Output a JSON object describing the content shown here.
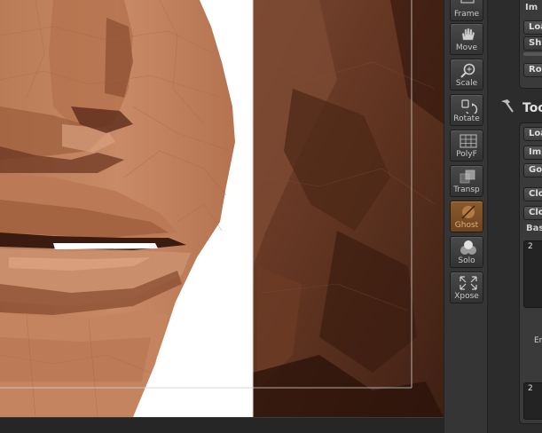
{
  "shelf": {
    "frame_label": "Frame",
    "move_label": "Move",
    "scale_label": "Scale",
    "rotate_label": "Rotate",
    "polyf_label": "PolyF",
    "transp_label": "Transp",
    "ghost_label": "Ghost",
    "solo_label": "Solo",
    "xpose_label": "Xpose"
  },
  "tray": {
    "image_panel": {
      "header": "Im",
      "load_label": "Loa",
      "shift_label": "Shi",
      "r_label": "Ro"
    },
    "tool_header": "Too",
    "tool_panel": {
      "load_label": "Loa",
      "import_label": "Imp",
      "goz_label": "Goz",
      "clone_label": "Clon",
      "clone2_label": "Clon",
      "base_label": "Bas",
      "thumb1_count": "2",
      "er_label": "Er",
      "thumb2_count": "2"
    }
  },
  "colors": {
    "skin_light": "#c98a67",
    "skin_mid": "#a5643f",
    "skin_dark": "#5e3320",
    "ui_panel": "#3a3a3a",
    "ghost_active": "#8a5a2c"
  }
}
